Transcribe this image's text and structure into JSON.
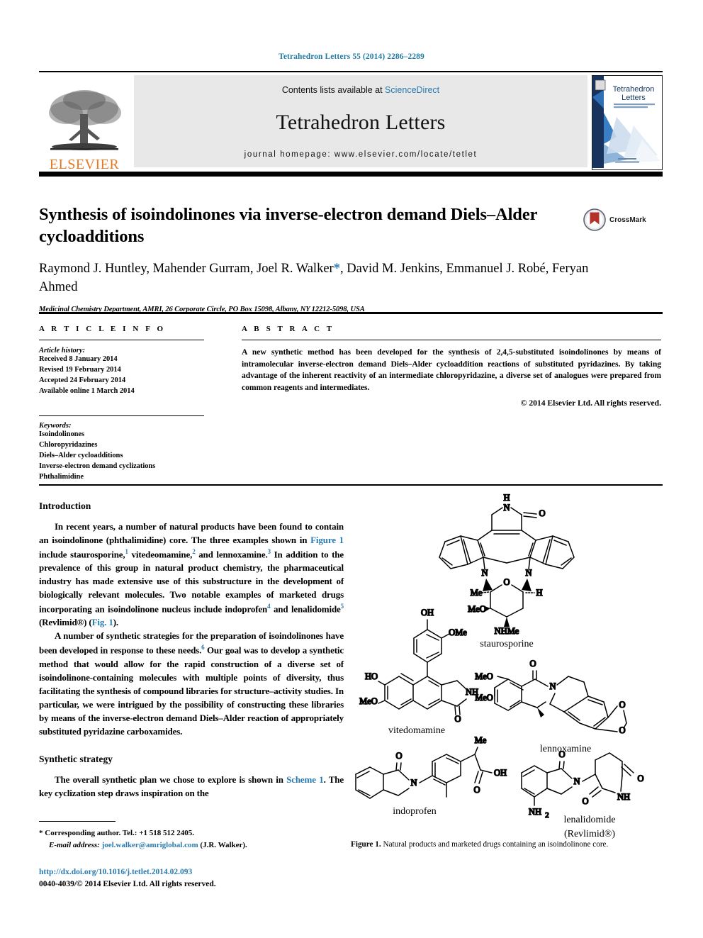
{
  "running_head": "Tetrahedron Letters 55 (2014) 2286–2289",
  "masthead": {
    "contents_prefix": "Contents lists available at ",
    "sciencedirect": "ScienceDirect",
    "journal_name": "Tetrahedron Letters",
    "homepage": "journal homepage: www.elsevier.com/locate/tetlet",
    "publisher": "ELSEVIER",
    "cover_title_line1": "Tetrahedron",
    "cover_title_line2": "Letters",
    "accent_orange": "#E87722",
    "link_blue": "#2a7ab0"
  },
  "title": "Synthesis of isoindolinones via inverse-electron demand Diels–Alder cycloadditions",
  "crossmark_label": "CrossMark",
  "authors_pre": "Raymond J. Huntley, Mahender Gurram, Joel R. Walker",
  "authors_post": ", David M. Jenkins, Emmanuel J. Robé, Feryan Ahmed",
  "corresponding_marker": "*",
  "affiliation": "Medicinal Chemistry Department, AMRI, 26 Corporate Circle, PO Box 15098, Albany, NY 12212-5098, USA",
  "article_info": {
    "heading": "A R T I C L E   I N F O",
    "history_label": "Article history:",
    "history": [
      "Received 8 January 2014",
      "Revised 19 February 2014",
      "Accepted 24 February 2014",
      "Available online 1 March 2014"
    ],
    "keywords_label": "Keywords:",
    "keywords": [
      "Isoindolinones",
      "Chloropyridazines",
      "Diels–Alder cycloadditions",
      "Inverse-electron demand cyclizations",
      "Phthalimidine"
    ]
  },
  "abstract": {
    "heading": "A B S T R A C T",
    "text": "A new synthetic method has been developed for the synthesis of 2,4,5-substituted isoindolinones by means of intramolecular inverse-electron demand Diels–Alder cycloaddition reactions of substituted pyridazines. By taking advantage of the inherent reactivity of an intermediate chloropyridazine, a diverse set of analogues were prepared from common reagents and intermediates.",
    "copyright": "© 2014 Elsevier Ltd. All rights reserved."
  },
  "body": {
    "heading_intro": "Introduction",
    "para1_a": "In recent years, a number of natural products have been found to contain an isoindolinone (phthalimidine) core. The three examples shown in ",
    "para1_fig": "Figure 1",
    "para1_b": " include staurosporine,",
    "ref1": "1",
    "para1_c": " vitedeomamine,",
    "ref2": "2",
    "para1_d": " and lennoxamine.",
    "ref3": "3",
    "para1_e": " In addition to the prevalence of this group in natural product chemistry, the pharmaceutical industry has made extensive use of this substructure in the development of biologically relevant molecules. Two notable examples of marketed drugs incorporating an isoindolinone nucleus include indoprofen",
    "ref4": "4",
    "para1_f": " and lenalidomide",
    "ref5": "5",
    "para1_g": " (Revlimid®) (",
    "para1_figref2": "Fig. 1",
    "para1_h": ").",
    "para2_a": "A number of synthetic strategies for the preparation of isoindolinones have been developed in response to these needs.",
    "ref6": "6",
    "para2_b": " Our goal was to develop a synthetic method that would allow for the rapid construction of a diverse set of isoindolinone-containing molecules with multiple points of diversity, thus facilitating the synthesis of compound libraries for structure–activity studies. In particular, we were intrigued by the possibility of constructing these libraries by means of the inverse-electron demand Diels–Alder reaction of appropriately substituted pyridazine carboxamides.",
    "heading_strategy": "Synthetic strategy",
    "para3_a": "The overall synthetic plan we chose to explore is shown in ",
    "para3_scheme": "Scheme 1",
    "para3_b": ". The key cyclization step draws inspiration on the"
  },
  "footnote": {
    "star": "*",
    "corresponding": "Corresponding author. Tel.: +1 518 512 2405.",
    "email_label": "E-mail address:",
    "email": "joel.walker@amriglobal.com",
    "email_owner": "(J.R. Walker)."
  },
  "footer": {
    "doi": "http://dx.doi.org/10.1016/j.tetlet.2014.02.093",
    "issn_line": "0040-4039/© 2014 Elsevier Ltd. All rights reserved."
  },
  "figure": {
    "caption_label": "Figure 1.",
    "caption_text": " Natural products and marketed drugs containing an isoindolinone core.",
    "compounds": [
      {
        "name": "staurosporine",
        "atoms": [
          "H",
          "N",
          "O",
          "N",
          "N",
          "O",
          "Me",
          "H",
          "MeO",
          "NHMe"
        ]
      },
      {
        "name": "vitedomamine",
        "atoms": [
          "OH",
          "OMe",
          "HO",
          "MeO",
          "NH",
          "O"
        ]
      },
      {
        "name": "lennoxamine",
        "atoms": [
          "O",
          "MeO",
          "MeO",
          "N",
          "O",
          "O"
        ]
      },
      {
        "name": "indoprofen",
        "atoms": [
          "O",
          "N",
          "Me",
          "OH",
          "O"
        ]
      },
      {
        "name": "lenalidomide",
        "name2": "(Revlimid®)",
        "atoms": [
          "O",
          "N",
          "O",
          "NH",
          "O",
          "NH2"
        ]
      }
    ]
  }
}
